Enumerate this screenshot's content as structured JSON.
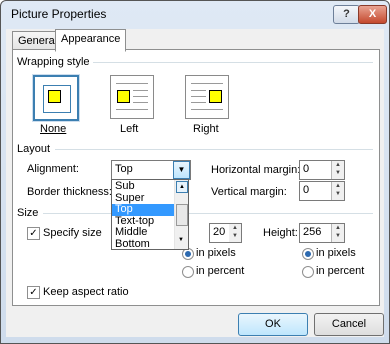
{
  "window": {
    "title": "Picture Properties",
    "help_label": "?",
    "close_label": "X"
  },
  "tabs": [
    {
      "label": "General"
    },
    {
      "label": "Appearance"
    }
  ],
  "wrapping": {
    "heading": "Wrapping style",
    "options": [
      {
        "label": "None"
      },
      {
        "label": "Left"
      },
      {
        "label": "Right"
      }
    ],
    "selected": "None"
  },
  "layout": {
    "heading": "Layout",
    "alignment_label": "Alignment:",
    "alignment_value": "Top",
    "alignment_options": [
      "Sub",
      "Super",
      "Top",
      "Text-top",
      "Middle",
      "Bottom"
    ],
    "border_label": "Border thickness:",
    "hmargin_label": "Horizontal margin:",
    "hmargin_value": "0",
    "vmargin_label": "Vertical margin:",
    "vmargin_value": "0"
  },
  "size": {
    "heading": "Size",
    "specify_label": "Specify size",
    "width_value": "20",
    "height_label": "Height:",
    "height_value": "256",
    "in_pixels": "in pixels",
    "in_percent": "in percent",
    "keep_aspect": "Keep aspect ratio"
  },
  "buttons": {
    "ok": "OK",
    "cancel": "Cancel"
  }
}
